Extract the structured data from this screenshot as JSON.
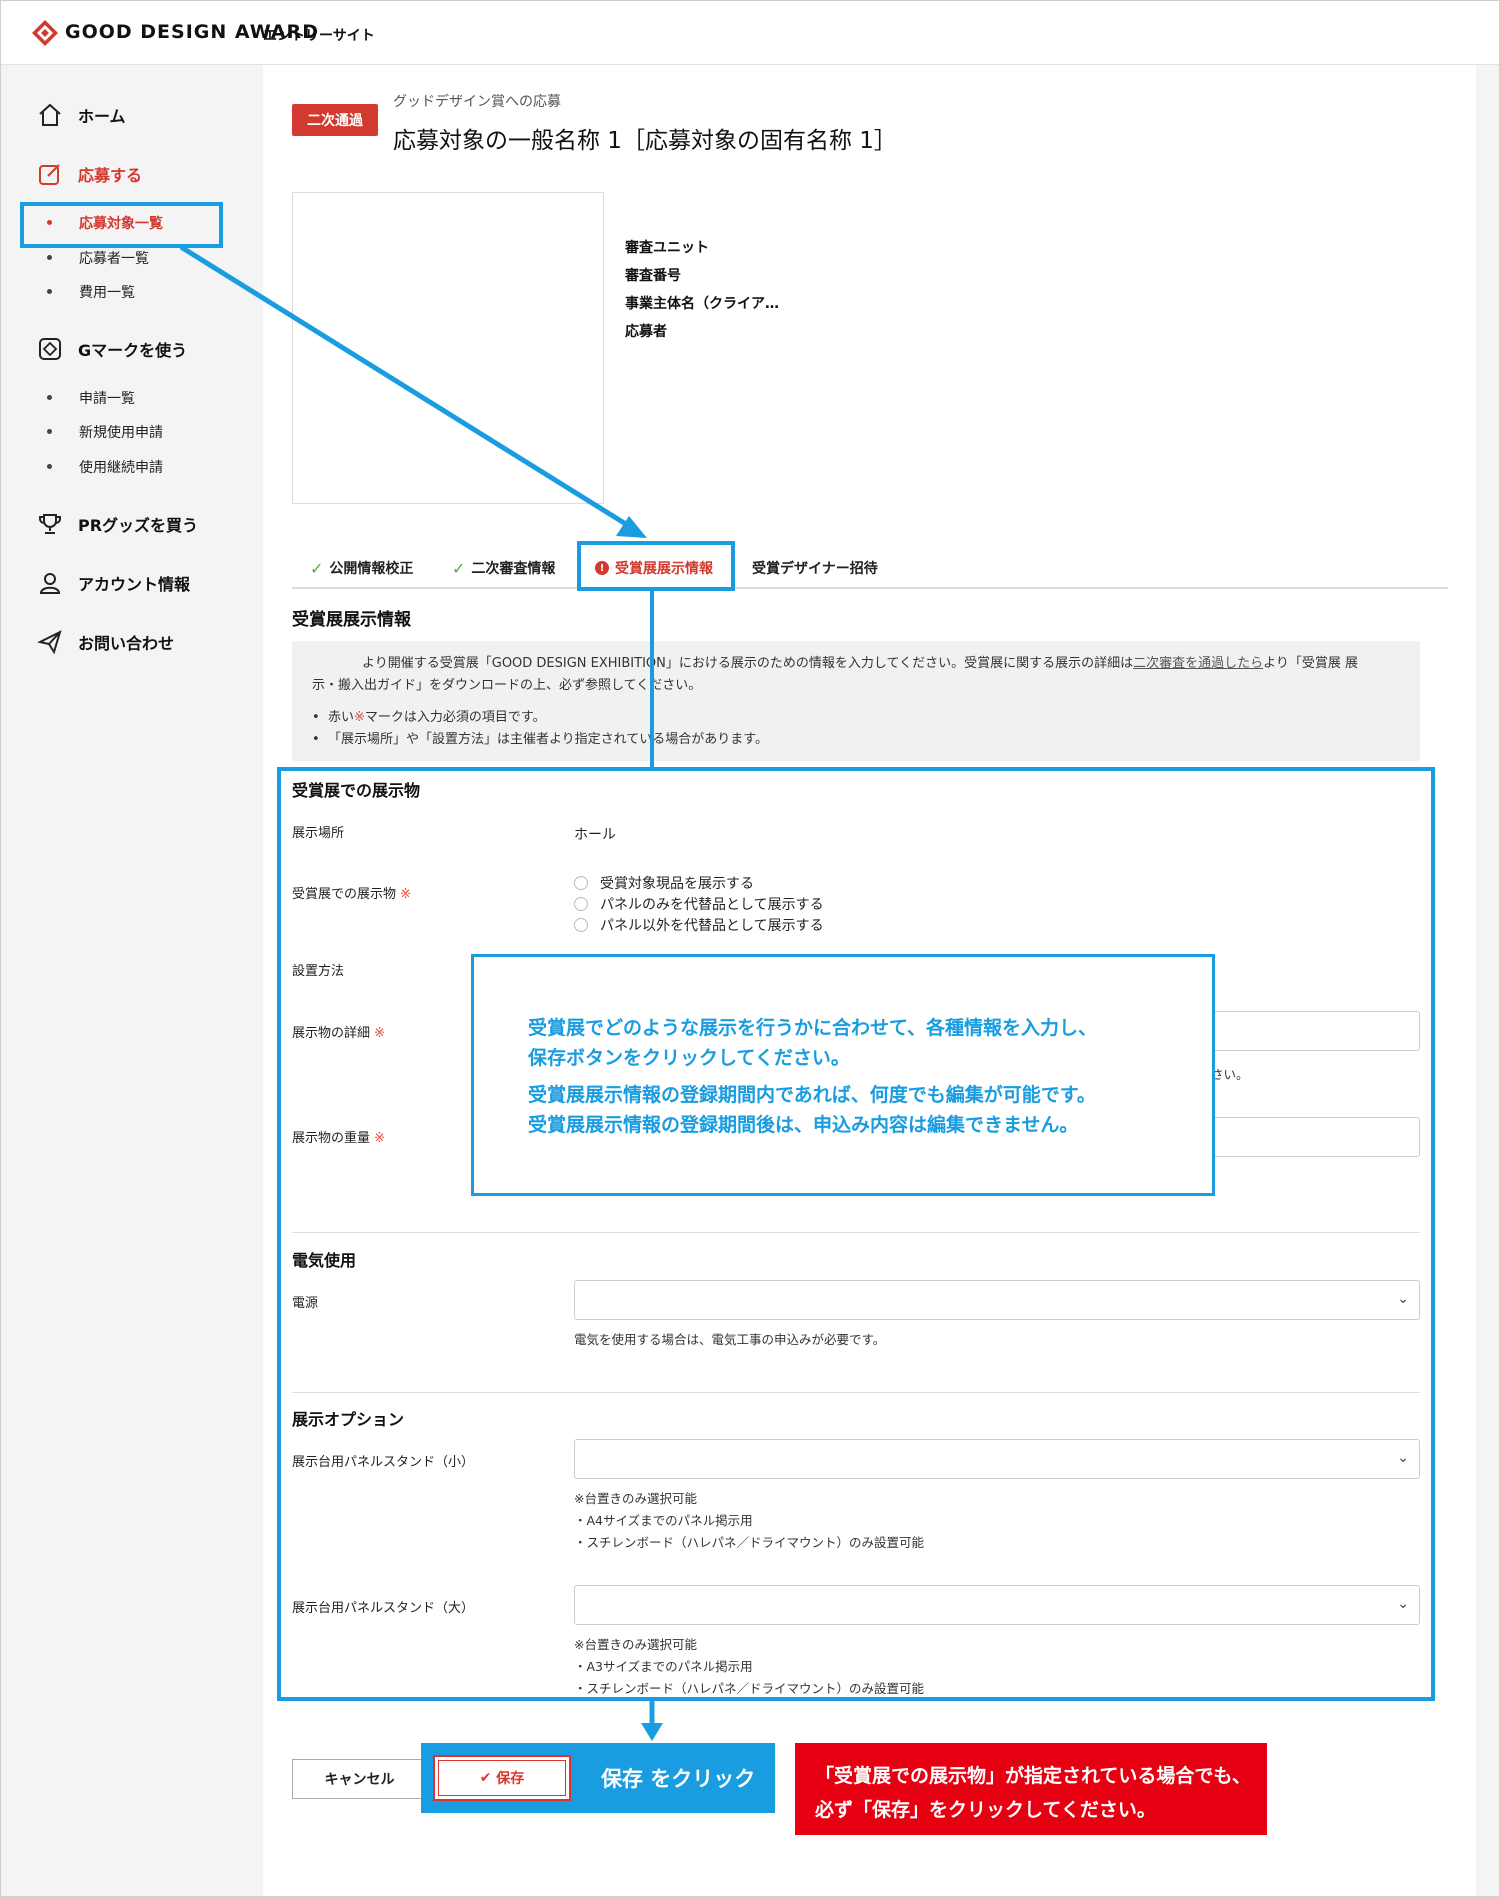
{
  "header": {
    "brand": "GOOD DESIGN AWARD",
    "brand_sub": "エントリーサイト"
  },
  "sidebar": {
    "nav": [
      {
        "label": "ホーム",
        "icon": "home-icon"
      },
      {
        "label": "応募する",
        "icon": "edit-icon"
      },
      {
        "label": "Gマークを使う",
        "icon": "gmark-icon"
      },
      {
        "label": "PRグッズを買う",
        "icon": "trophy-icon"
      },
      {
        "label": "アカウント情報",
        "icon": "user-icon"
      },
      {
        "label": "お問い合わせ",
        "icon": "send-icon"
      }
    ],
    "apply_sub": [
      "応募対象一覧",
      "応募者一覧",
      "費用一覧"
    ],
    "gmark_sub": [
      "申請一覧",
      "新規使用申請",
      "使用継続申請"
    ]
  },
  "page": {
    "badge": "二次通過",
    "pre_title": "グッドデザイン賞への応募",
    "title": "応募対象の一般名称 1［応募対象の固有名称 1］",
    "meta": [
      "審査ユニット",
      "審査番号",
      "事業主体名（クライア…",
      "応募者"
    ]
  },
  "tabs": [
    "公開情報校正",
    "二次審査情報",
    "受賞展展示情報",
    "受賞デザイナー招待"
  ],
  "section_title": "受賞展展示情報",
  "info": {
    "line1a": "より開催する受賞展「GOOD DESIGN EXHIBITION」における展示のための情報を入力してください。受賞展に関する展示の詳細は",
    "line1_link": "二次審査を通過したら",
    "line1b": "より「受賞展 展",
    "line2": "示・搬入出ガイド」をダウンロードの上、必ず参照してください。",
    "bullet1a": "赤い",
    "bullet1_mark": "※",
    "bullet1b": "マークは入力必須の項目です。",
    "bullet2": "「展示場所」や「設置方法」は主催者より指定されている場合があります。"
  },
  "form": {
    "group1": "受賞展での展示物",
    "location_label": "展示場所",
    "location_value": "ホール",
    "exhibit_label": "受賞展での展示物",
    "required_mark": "※",
    "radios": [
      "受賞対象現品を展示する",
      "パネルのみを代替品として展示する",
      "パネル以外を代替品として展示する"
    ],
    "install_label": "設置方法",
    "detail_label": "展示物の詳細",
    "detail_note_tail": "さい。",
    "weight_label": "展示物の重量",
    "group2": "電気使用",
    "power_label": "電源",
    "power_note": "電気を使用する場合は、電気工事の申込みが必要です。",
    "group3": "展示オプション",
    "panel_small_label": "展示台用パネルスタンド（小）",
    "panel_small_notes": [
      "※台置きのみ選択可能",
      "・A4サイズまでのパネル掲示用",
      "・スチレンボード（ハレパネ／ドライマウント）のみ設置可能"
    ],
    "panel_large_label": "展示台用パネルスタンド（大）",
    "panel_large_notes": [
      "※台置きのみ選択可能",
      "・A3サイズまでのパネル掲示用",
      "・スチレンボード（ハレパネ／ドライマウント）のみ設置可能"
    ],
    "chevron": "⌄"
  },
  "callout": [
    "受賞展でどのような展示を行うかに合わせて、各種情報を入力し、",
    "保存ボタンをクリックしてください。",
    "受賞展展示情報の登録期間内であれば、何度でも編集が可能です。",
    "受賞展展示情報の登録期間後は、申込み内容は編集できません。"
  ],
  "buttons": {
    "cancel": "キャンセル",
    "save": "保存",
    "save_check": "✔"
  },
  "save_hint": "保存 をクリック",
  "red_note": [
    "「受賞展での展示物」が指定されている場合でも、",
    "必ず「保存」をクリックしてください。"
  ],
  "colors": {
    "accent_red": "#d2392f",
    "annotation_blue": "#1a9ce0",
    "alert_red": "#e60012",
    "check_green": "#5aa64a"
  }
}
